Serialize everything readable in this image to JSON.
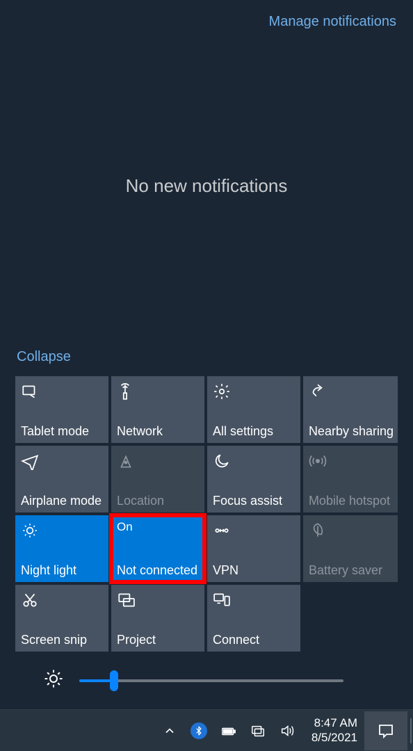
{
  "header": {
    "manage_label": "Manage notifications"
  },
  "notifications": {
    "empty_message": "No new notifications"
  },
  "collapse_label": "Collapse",
  "tiles": [
    {
      "id": "tablet-mode",
      "label": "Tablet mode",
      "icon": "tablet",
      "state": "normal"
    },
    {
      "id": "network",
      "label": "Network",
      "icon": "network",
      "state": "normal"
    },
    {
      "id": "all-settings",
      "label": "All settings",
      "icon": "gear",
      "state": "normal"
    },
    {
      "id": "nearby-sharing",
      "label": "Nearby sharing",
      "icon": "share",
      "state": "normal"
    },
    {
      "id": "airplane-mode",
      "label": "Airplane mode",
      "icon": "airplane",
      "state": "normal"
    },
    {
      "id": "location",
      "label": "Location",
      "icon": "location",
      "state": "disabled"
    },
    {
      "id": "focus-assist",
      "label": "Focus assist",
      "icon": "moon",
      "state": "normal"
    },
    {
      "id": "mobile-hotspot",
      "label": "Mobile hotspot",
      "icon": "hotspot",
      "state": "disabled"
    },
    {
      "id": "night-light",
      "label": "Night light",
      "icon": "nightlight",
      "state": "active"
    },
    {
      "id": "bluetooth",
      "label": "Not connected",
      "topline": "On",
      "icon": "bluetooth",
      "state": "active",
      "highlighted": true
    },
    {
      "id": "vpn",
      "label": "VPN",
      "icon": "vpn",
      "state": "normal"
    },
    {
      "id": "battery-saver",
      "label": "Battery saver",
      "icon": "leaf",
      "state": "disabled"
    },
    {
      "id": "screen-snip",
      "label": "Screen snip",
      "icon": "snip",
      "state": "normal"
    },
    {
      "id": "project",
      "label": "Project",
      "icon": "project",
      "state": "normal"
    },
    {
      "id": "connect",
      "label": "Connect",
      "icon": "connect",
      "state": "normal"
    }
  ],
  "brightness": {
    "value": 12
  },
  "taskbar": {
    "time": "8:47 AM",
    "date": "8/5/2021"
  },
  "colors": {
    "accent": "#0078d7",
    "highlight": "#ff0000"
  }
}
